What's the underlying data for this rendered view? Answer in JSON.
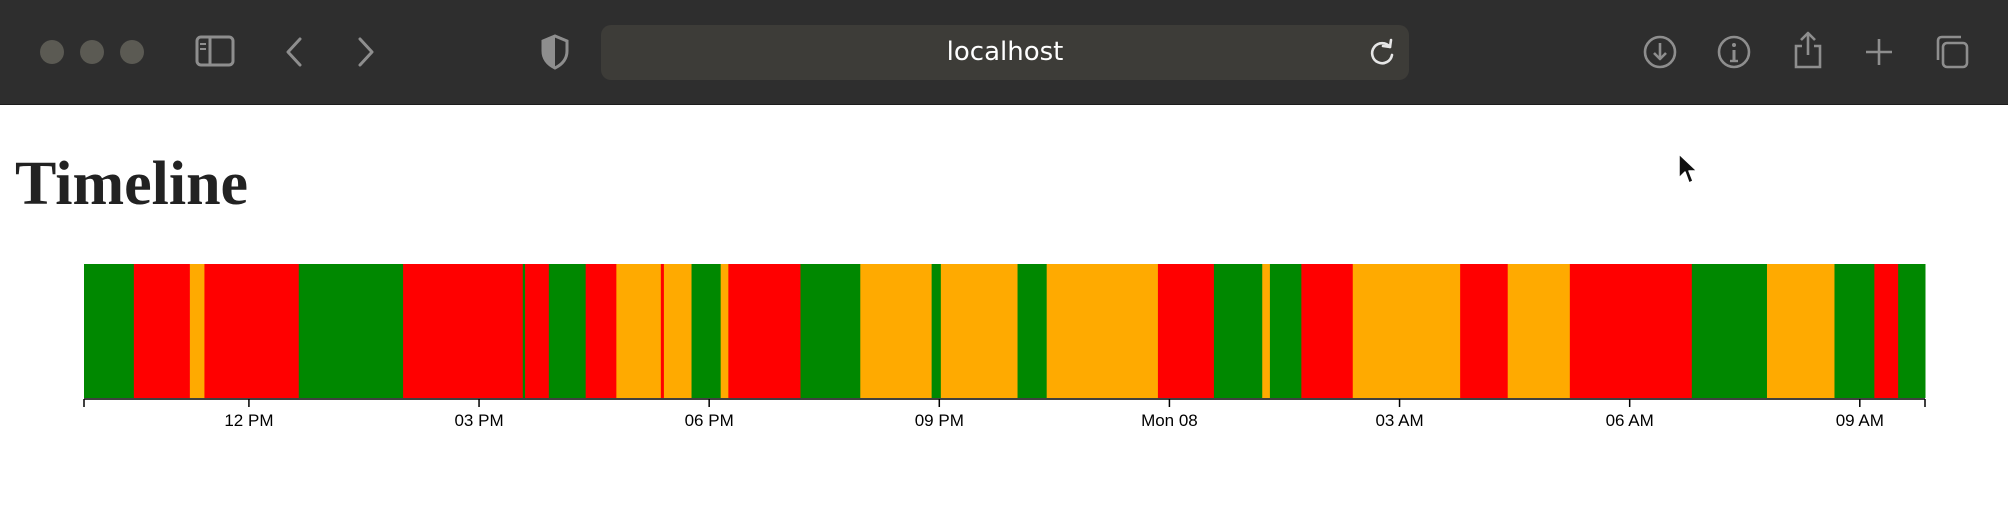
{
  "browser": {
    "url": "localhost",
    "colors": {
      "toolbar": "#2e2e2e",
      "address_bar": "#3d3c38",
      "icon": "#8e8e8e"
    }
  },
  "page": {
    "heading": "Timeline"
  },
  "chart_data": {
    "type": "bar",
    "subtype": "timeline",
    "title": "",
    "xlabel": "",
    "ylabel": "",
    "x_unit": "hours since the first tick (12 PM)",
    "xlim": [
      -2.15,
      21.85
    ],
    "grid": false,
    "legend": "none",
    "status_colors": {
      "green": "#008800",
      "red": "#ff0000",
      "orange": "#ffaa00"
    },
    "x_ticks": [
      {
        "value": 0,
        "label": "12 PM"
      },
      {
        "value": 3,
        "label": "03 PM"
      },
      {
        "value": 6,
        "label": "06 PM"
      },
      {
        "value": 9,
        "label": "09 PM"
      },
      {
        "value": 12,
        "label": "Mon 08"
      },
      {
        "value": 15,
        "label": "03 AM"
      },
      {
        "value": 18,
        "label": "06 AM"
      },
      {
        "value": 21,
        "label": "09 AM"
      }
    ],
    "segments": [
      {
        "start": -2.15,
        "end": -1.5,
        "status": "green"
      },
      {
        "start": -1.5,
        "end": -0.77,
        "status": "red"
      },
      {
        "start": -0.77,
        "end": -0.58,
        "status": "orange"
      },
      {
        "start": -0.58,
        "end": 0.65,
        "status": "red"
      },
      {
        "start": 0.65,
        "end": 2.01,
        "status": "green"
      },
      {
        "start": 2.01,
        "end": 3.57,
        "status": "red"
      },
      {
        "start": 3.57,
        "end": 3.6,
        "status": "green"
      },
      {
        "start": 3.6,
        "end": 3.91,
        "status": "red"
      },
      {
        "start": 3.91,
        "end": 4.39,
        "status": "green"
      },
      {
        "start": 4.39,
        "end": 4.79,
        "status": "red"
      },
      {
        "start": 4.79,
        "end": 5.37,
        "status": "orange"
      },
      {
        "start": 5.37,
        "end": 5.41,
        "status": "red"
      },
      {
        "start": 5.41,
        "end": 5.77,
        "status": "orange"
      },
      {
        "start": 5.77,
        "end": 6.15,
        "status": "green"
      },
      {
        "start": 6.15,
        "end": 6.25,
        "status": "orange"
      },
      {
        "start": 6.25,
        "end": 7.19,
        "status": "red"
      },
      {
        "start": 7.19,
        "end": 7.97,
        "status": "green"
      },
      {
        "start": 7.97,
        "end": 8.9,
        "status": "orange"
      },
      {
        "start": 8.9,
        "end": 9.02,
        "status": "green"
      },
      {
        "start": 9.02,
        "end": 10.02,
        "status": "orange"
      },
      {
        "start": 10.02,
        "end": 10.4,
        "status": "green"
      },
      {
        "start": 10.4,
        "end": 11.85,
        "status": "orange"
      },
      {
        "start": 11.85,
        "end": 12.58,
        "status": "red"
      },
      {
        "start": 12.58,
        "end": 13.21,
        "status": "green"
      },
      {
        "start": 13.21,
        "end": 13.31,
        "status": "orange"
      },
      {
        "start": 13.31,
        "end": 13.72,
        "status": "green"
      },
      {
        "start": 13.72,
        "end": 14.39,
        "status": "red"
      },
      {
        "start": 14.39,
        "end": 15.79,
        "status": "orange"
      },
      {
        "start": 15.79,
        "end": 16.41,
        "status": "red"
      },
      {
        "start": 16.41,
        "end": 17.22,
        "status": "orange"
      },
      {
        "start": 17.22,
        "end": 18.81,
        "status": "red"
      },
      {
        "start": 18.81,
        "end": 19.79,
        "status": "green"
      },
      {
        "start": 19.79,
        "end": 20.67,
        "status": "orange"
      },
      {
        "start": 20.67,
        "end": 21.19,
        "status": "green"
      },
      {
        "start": 21.19,
        "end": 21.5,
        "status": "red"
      },
      {
        "start": 21.5,
        "end": 21.85,
        "status": "green"
      }
    ]
  }
}
